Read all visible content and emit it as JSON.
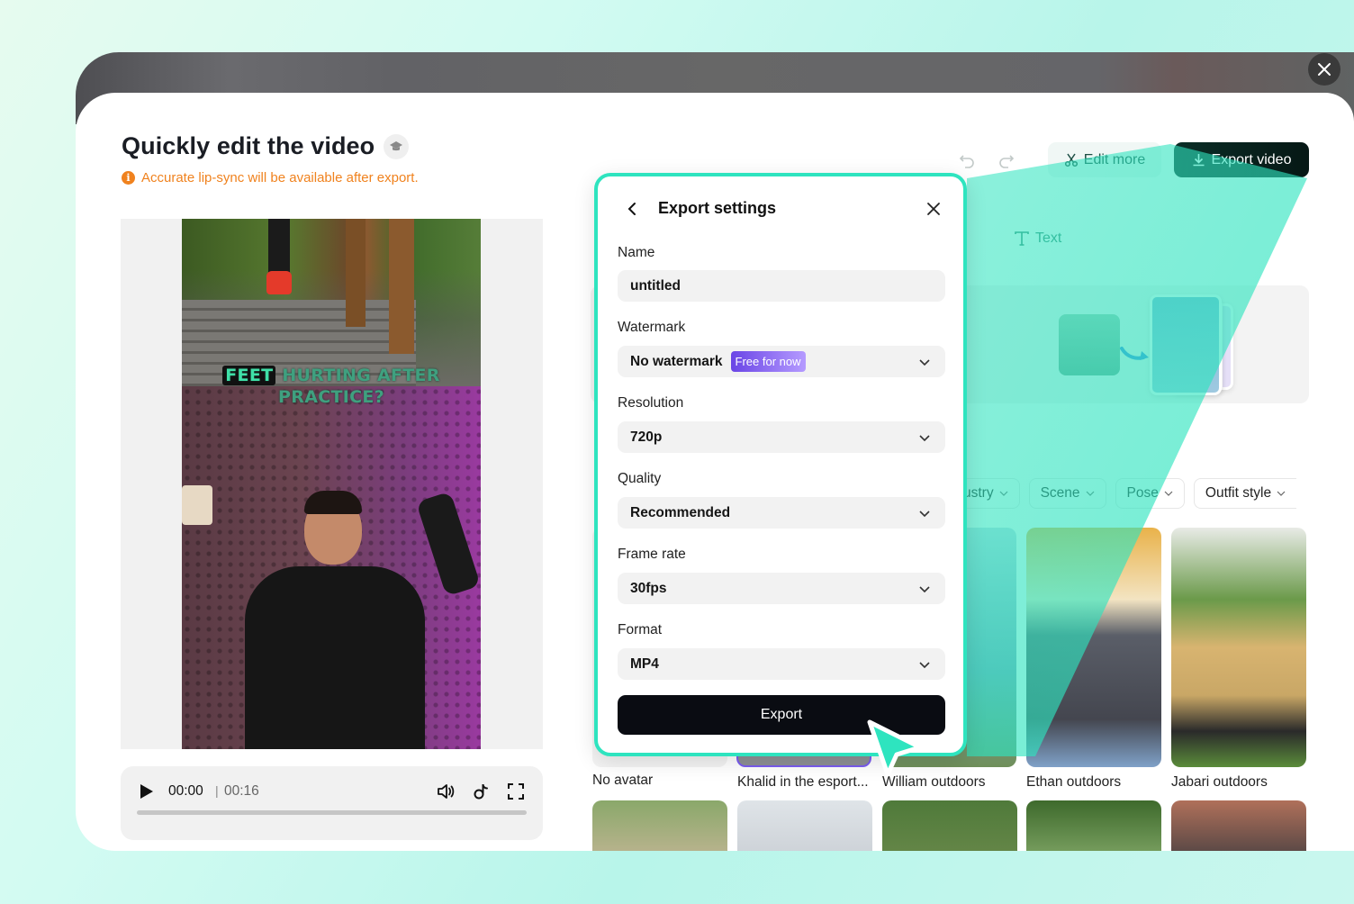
{
  "window": {
    "close_label": "Close"
  },
  "header": {
    "title": "Quickly edit the video",
    "tutorial_icon": "graduation-cap-icon",
    "notice": "Accurate lip-sync will be available after export.",
    "notice_icon": "info-icon"
  },
  "video": {
    "caption_highlight": "FEET",
    "caption_rest_line1": "HURTING AFTER",
    "caption_line2": "PRACTICE?"
  },
  "player": {
    "current_time": "00:00",
    "separator": "|",
    "total_time": "00:16",
    "progress_percent": 0,
    "icons": [
      "play-icon",
      "volume-icon",
      "tiktok-icon",
      "fullscreen-icon"
    ]
  },
  "toolbar": {
    "undo_icon": "undo-icon",
    "redo_icon": "redo-icon",
    "edit_more_label": "Edit more",
    "export_video_label": "Export video",
    "text_tool_label": "Text"
  },
  "filters": [
    {
      "label": "Industry",
      "visible_label": "ustry"
    },
    {
      "label": "Scene"
    },
    {
      "label": "Pose"
    },
    {
      "label": "Outfit style"
    }
  ],
  "avatars": [
    {
      "name": "No avatar"
    },
    {
      "name": "Khalid in the esport..."
    },
    {
      "name": "William outdoors"
    },
    {
      "name": "Ethan outdoors"
    },
    {
      "name": "Jabari outdoors"
    }
  ],
  "export_settings": {
    "title": "Export settings",
    "fields": [
      {
        "label": "Name",
        "value": "untitled",
        "type": "text"
      },
      {
        "label": "Watermark",
        "value": "No watermark",
        "badge": "Free for now",
        "type": "select"
      },
      {
        "label": "Resolution",
        "value": "720p",
        "type": "select"
      },
      {
        "label": "Quality",
        "value": "Recommended",
        "type": "select"
      },
      {
        "label": "Frame rate",
        "value": "30fps",
        "type": "select"
      },
      {
        "label": "Format",
        "value": "MP4",
        "type": "select"
      }
    ],
    "export_label": "Export"
  },
  "colors": {
    "accent_teal": "#2ee4bf",
    "notice_orange": "#f0821e",
    "badge_purple": "#6a45e6",
    "export_dark": "#0a0c12"
  }
}
